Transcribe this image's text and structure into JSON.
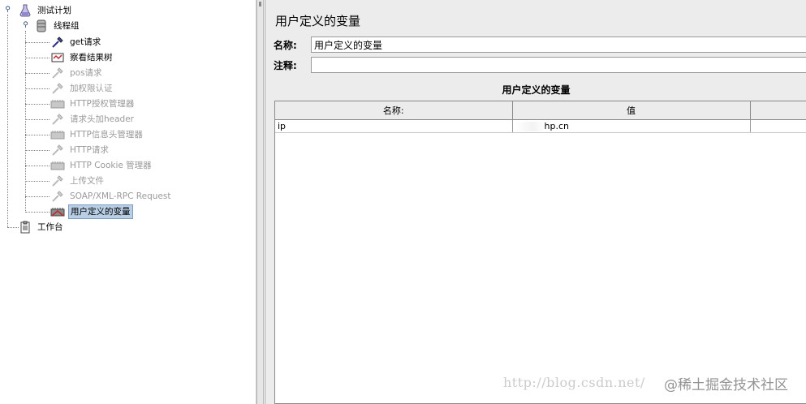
{
  "tree": {
    "root": {
      "label": "测试计划"
    },
    "thread_group": {
      "label": "线程组"
    },
    "children": [
      {
        "label": "get请求",
        "enabled": true
      },
      {
        "label": "察看结果树",
        "enabled": true
      },
      {
        "label": "pos请求",
        "enabled": false
      },
      {
        "label": "加权限认证",
        "enabled": false
      },
      {
        "label": "HTTP授权管理器",
        "enabled": false
      },
      {
        "label": "请求头加header",
        "enabled": false
      },
      {
        "label": "HTTP信息头管理器",
        "enabled": false
      },
      {
        "label": "HTTP请求",
        "enabled": false
      },
      {
        "label": "HTTP Cookie 管理器",
        "enabled": false
      },
      {
        "label": "上传文件",
        "enabled": false
      },
      {
        "label": "SOAP/XML-RPC Request",
        "enabled": false
      },
      {
        "label": "用户定义的变量",
        "enabled": true,
        "selected": true
      }
    ],
    "workbench": {
      "label": "工作台"
    }
  },
  "panel": {
    "title": "用户定义的变量",
    "name_label": "名称:",
    "name_value": "用户定义的变量",
    "comment_label": "注释:",
    "comment_value": "",
    "table_title": "用户定义的变量"
  },
  "vars_table": {
    "headers": [
      "名称:",
      "值",
      ""
    ],
    "rows": [
      {
        "name": "ip",
        "value": "hp.cn",
        "description": ""
      }
    ]
  },
  "watermark": {
    "url": "http://blog.csdn.net/",
    "site": "@稀土掘金技术社区"
  },
  "colors": {
    "selection_bg": "#b8cfe5",
    "disabled_text": "#9a9a9a",
    "panel_bg": "#ececec"
  }
}
